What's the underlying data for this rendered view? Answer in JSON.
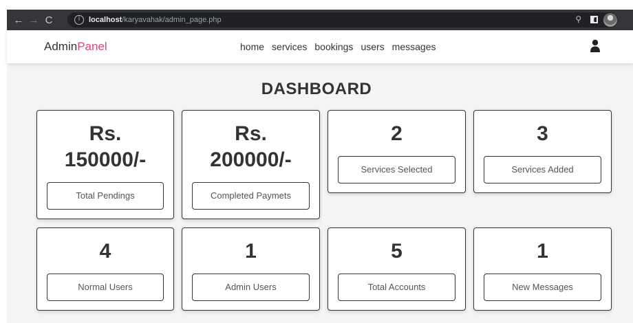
{
  "browser": {
    "url_host": "localhost",
    "url_path": "/karyavahak/admin_page.php"
  },
  "header": {
    "logo_main": "Admin",
    "logo_accent": "Panel",
    "nav": [
      "home",
      "services",
      "bookings",
      "users",
      "messages"
    ]
  },
  "page_title": "DASHBOARD",
  "cards": [
    {
      "value_line1": "Rs.",
      "value_line2": "150000/-",
      "label": "Total Pendings"
    },
    {
      "value_line1": "Rs.",
      "value_line2": "200000/-",
      "label": "Completed Paymets"
    },
    {
      "value": "2",
      "label": "Services Selected"
    },
    {
      "value": "3",
      "label": "Services Added"
    },
    {
      "value": "4",
      "label": "Normal Users"
    },
    {
      "value": "1",
      "label": "Admin Users"
    },
    {
      "value": "5",
      "label": "Total Accounts"
    },
    {
      "value": "1",
      "label": "New Messages"
    }
  ],
  "colors": {
    "accent": "#e0457b",
    "text": "#333333",
    "page_bg": "#f4f4f4"
  }
}
